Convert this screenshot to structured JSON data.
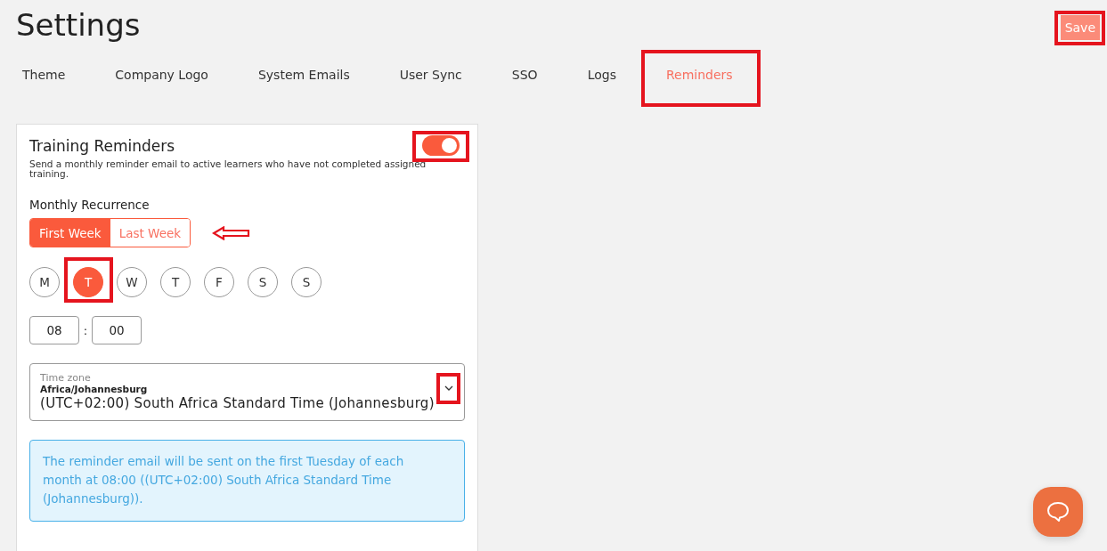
{
  "page": {
    "title": "Settings"
  },
  "save_button": {
    "label": "Save",
    "highlighted": true
  },
  "tabs": [
    {
      "label": "Theme",
      "selected": false,
      "highlighted": false
    },
    {
      "label": "Company Logo",
      "selected": false,
      "highlighted": false
    },
    {
      "label": "System Emails",
      "selected": false,
      "highlighted": false
    },
    {
      "label": "User Sync",
      "selected": false,
      "highlighted": false
    },
    {
      "label": "SSO",
      "selected": false,
      "highlighted": false
    },
    {
      "label": "Logs",
      "selected": false,
      "highlighted": false
    },
    {
      "label": "Reminders",
      "selected": true,
      "highlighted": true
    }
  ],
  "card": {
    "title": "Training Reminders",
    "enabled": true,
    "toggle_highlighted": true,
    "description": "Send a monthly reminder email to active learners who have not completed assigned training.",
    "recurrence_label": "Monthly Recurrence",
    "weeks": [
      {
        "label": "First Week",
        "selected": true
      },
      {
        "label": "Last Week",
        "selected": false
      }
    ],
    "days": [
      {
        "label": "M",
        "selected": false,
        "highlighted": false
      },
      {
        "label": "T",
        "selected": true,
        "highlighted": true
      },
      {
        "label": "W",
        "selected": false,
        "highlighted": false
      },
      {
        "label": "T",
        "selected": false,
        "highlighted": false
      },
      {
        "label": "F",
        "selected": false,
        "highlighted": false
      },
      {
        "label": "S",
        "selected": false,
        "highlighted": false
      },
      {
        "label": "S",
        "selected": false,
        "highlighted": false
      }
    ],
    "time": {
      "hour": "08",
      "separator": ":",
      "minute": "00"
    },
    "timezone": {
      "label": "Time zone",
      "value_title": "Africa/Johannesburg",
      "value": "(UTC+02:00) South Africa Standard Time (Johannesburg)",
      "chevron_highlighted": true
    },
    "info": "The reminder email will be sent on the first Tuesday of each month at 08:00 ((UTC+02:00) South Africa Standard Time (Johannesburg))."
  }
}
